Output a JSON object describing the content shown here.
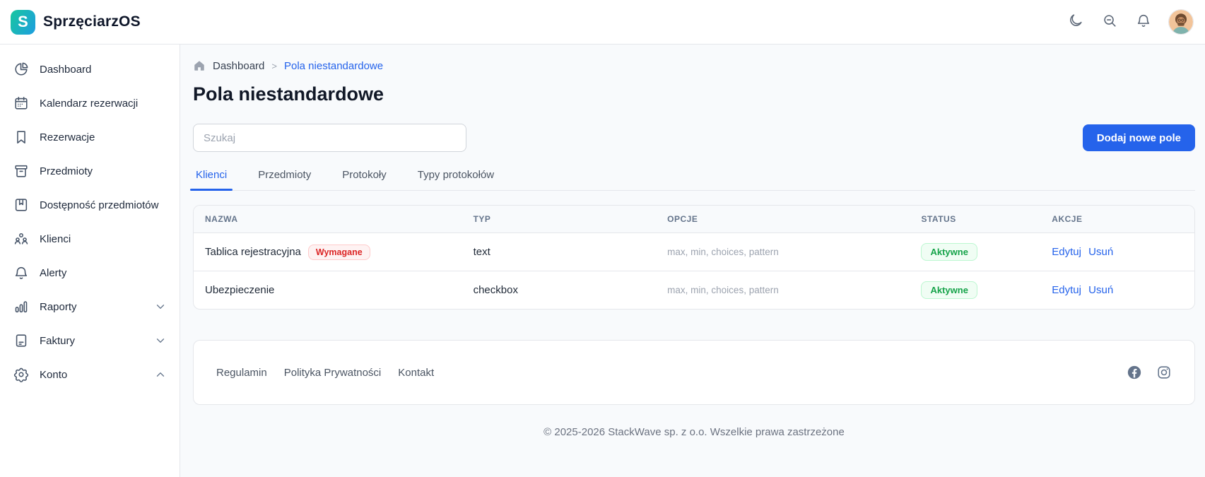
{
  "brand": {
    "name": "SprzęciarzOS",
    "logo_letter": "S"
  },
  "header": {
    "icons": [
      "moon",
      "zoom-out",
      "bell"
    ],
    "avatar": "user-avatar"
  },
  "sidebar": {
    "items": [
      {
        "label": "Dashboard",
        "icon": "pie-chart",
        "chevron": null
      },
      {
        "label": "Kalendarz rezerwacji",
        "icon": "calendar",
        "chevron": null
      },
      {
        "label": "Rezerwacje",
        "icon": "bookmark",
        "chevron": null
      },
      {
        "label": "Przedmioty",
        "icon": "archive-box",
        "chevron": null
      },
      {
        "label": "Dostępność przedmiotów",
        "icon": "book-bookmark",
        "chevron": null
      },
      {
        "label": "Klienci",
        "icon": "users",
        "chevron": null
      },
      {
        "label": "Alerty",
        "icon": "bell",
        "chevron": null
      },
      {
        "label": "Raporty",
        "icon": "bar-chart",
        "chevron": "down"
      },
      {
        "label": "Faktury",
        "icon": "document",
        "chevron": "down"
      },
      {
        "label": "Konto",
        "icon": "gear",
        "chevron": "up"
      }
    ]
  },
  "breadcrumb": {
    "home_item": "Dashboard",
    "separator": ">",
    "current": "Pola niestandardowe"
  },
  "page": {
    "title": "Pola niestandardowe"
  },
  "search": {
    "placeholder": "Szukaj",
    "value": ""
  },
  "toolbar": {
    "add_button_label": "Dodaj nowe pole"
  },
  "tabs": [
    {
      "label": "Klienci",
      "active": true
    },
    {
      "label": "Przedmioty",
      "active": false
    },
    {
      "label": "Protokoły",
      "active": false
    },
    {
      "label": "Typy protokołów",
      "active": false
    }
  ],
  "table": {
    "columns": [
      "NAZWA",
      "TYP",
      "OPCJE",
      "STATUS",
      "AKCJE"
    ],
    "rows": [
      {
        "name": "Tablica rejestracyjna",
        "badge": "Wymagane",
        "type": "text",
        "options": "max, min, choices, pattern",
        "status": "Aktywne",
        "actions": [
          "Edytuj",
          "Usuń"
        ]
      },
      {
        "name": "Ubezpieczenie",
        "badge": null,
        "type": "checkbox",
        "options": "max, min, choices, pattern",
        "status": "Aktywne",
        "actions": [
          "Edytuj",
          "Usuń"
        ]
      }
    ]
  },
  "footer": {
    "links": [
      "Regulamin",
      "Polityka Prywatności",
      "Kontakt"
    ],
    "social": [
      "facebook",
      "instagram"
    ]
  },
  "copyright": "© 2025-2026 StackWave sp. z o.o. Wszelkie prawa zastrzeżone",
  "colors": {
    "accent": "#2563eb",
    "logo_gradient_start": "#19c3a5",
    "logo_gradient_end": "#1d9fdd",
    "status_active_text": "#16a34a",
    "status_active_bg": "#f0fdf4",
    "badge_required_text": "#dc2626",
    "badge_required_bg": "#fef2f2"
  }
}
